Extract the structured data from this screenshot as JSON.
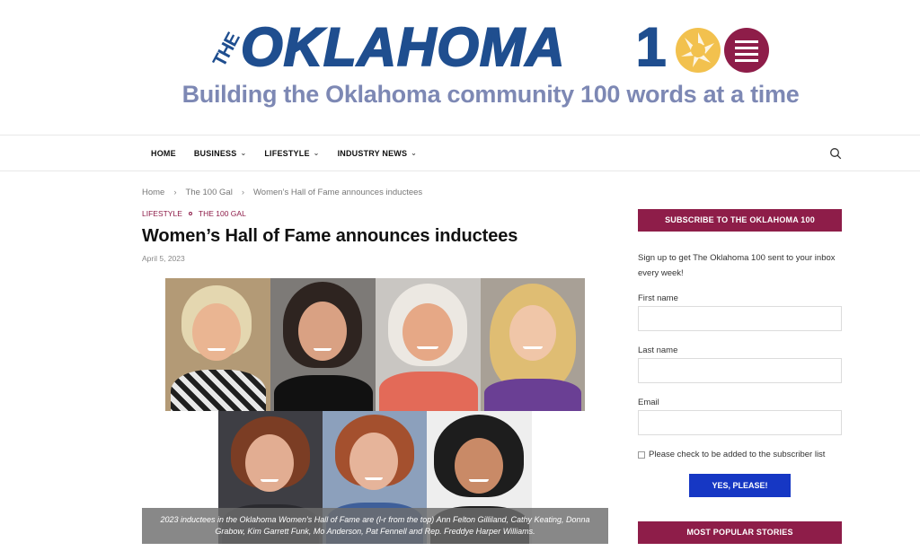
{
  "logo": {
    "the": "THE",
    "word": "OKLAHOMA",
    "number_prefix": "1",
    "tagline": "Building the Oklahoma community 100 words at a time"
  },
  "nav": {
    "items": [
      {
        "label": "HOME",
        "has_dropdown": false
      },
      {
        "label": "BUSINESS",
        "has_dropdown": true
      },
      {
        "label": "LIFESTYLE",
        "has_dropdown": true
      },
      {
        "label": "INDUSTRY NEWS",
        "has_dropdown": true
      }
    ],
    "search_icon": "search-icon"
  },
  "breadcrumb": {
    "items": [
      "Home",
      "The 100 Gal",
      "Women’s Hall of Fame announces inductees"
    ],
    "separator": "›"
  },
  "article": {
    "categories": [
      "LIFESTYLE",
      "THE 100 GAL"
    ],
    "title": "Women’s Hall of Fame announces inductees",
    "date": "April 5, 2023",
    "caption": "2023 inductees in the Oklahoma Women's Hall of Fame are (l-r from the top) Ann Felton Gilliland, Cathy Keating, Donna Grabow, Kim Garrett Funk, Mo Anderson, Pat Fennell and Rep. Freddye Harper Williams."
  },
  "sidebar": {
    "subscribe_heading": "SUBSCRIBE TO THE OKLAHOMA 100",
    "signup_text": "Sign up to get The Oklahoma 100 sent to your inbox every week!",
    "first_name_label": "First name",
    "last_name_label": "Last name",
    "email_label": "Email",
    "checkbox_label": "Please check to be added to the subscriber list",
    "submit_label": "YES, PLEASE!",
    "popular_heading": "MOST POPULAR STORIES"
  },
  "colors": {
    "brand_blue": "#1f4e8f",
    "tagline": "#7d88b4",
    "accent_maroon": "#8e1d49",
    "aperture_yellow": "#f2c14e",
    "button_blue": "#1637c4"
  }
}
